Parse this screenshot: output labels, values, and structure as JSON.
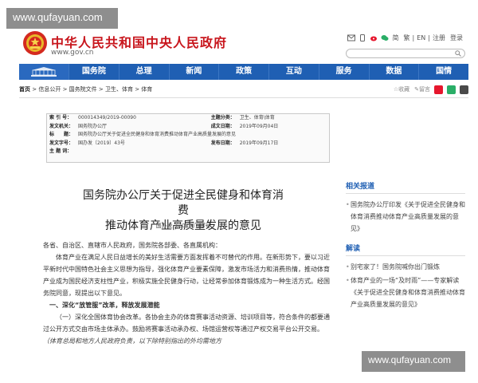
{
  "watermark": {
    "top": "www.qufayuan.com",
    "bottom": "www.qufayuan.com"
  },
  "header": {
    "title": "中华人民共和国中央人民政府",
    "url": "www.gov.cn",
    "links": [
      "简",
      "繁",
      "EN",
      "注册",
      "登录"
    ],
    "separators": [
      "|",
      "|"
    ]
  },
  "nav": {
    "items": [
      "国务院",
      "总理",
      "新闻",
      "政策",
      "互动",
      "服务",
      "数据",
      "国情"
    ]
  },
  "breadcrumb": {
    "items": [
      "首页",
      "信息公开",
      "国务院文件",
      "卫生、体育",
      "体育"
    ],
    "separator": " > ",
    "tools": {
      "favorite": "收藏",
      "print": "留言"
    }
  },
  "meta": {
    "rows": [
      {
        "k1": "索 引 号：",
        "v1": "000014349/2019-00090",
        "k2": "主题分类：",
        "v2": "卫生、体育\\体育"
      },
      {
        "k1": "发文机关：",
        "v1": "国务院办公厅",
        "k2": "成文日期：",
        "v2": "2019年09月04日"
      },
      {
        "k1": "标　　题：",
        "v1": "国务院办公厅关于促进全民健身和体育消费推动体育产业高质量发展的意见",
        "k2": "",
        "v2": ""
      },
      {
        "k1": "发文字号：",
        "v1": "国办发〔2019〕43号",
        "k2": "发布日期：",
        "v2": "2019年09月17日"
      },
      {
        "k1": "主 题 词：",
        "v1": "",
        "k2": "",
        "v2": ""
      }
    ]
  },
  "doc": {
    "title_line1": "国务院办公厅关于促进全民健身和体育消费",
    "title_line2": "推动体育产业高质量发展的意见",
    "number": "国办发〔2019〕43号",
    "salutation": "各省、自治区、直辖市人民政府，国务院各部委、各直属机构：",
    "p1": "体育产业在满足人民日益增长的美好生活需要方面发挥着不可替代的作用。在新形势下，要以习近平新时代中国特色社会主义思想为指导，强化体育产业要素保障，激发市场活力和消费热情，推动体育产业成为国民经济支柱性产业，积极实施全民健身行动，让经常参加体育锻炼成为一种生活方式。经国务院同意，现提出以下意见。",
    "h1": "一、深化“放管服”改革，释放发展潜能",
    "p2a": "（一）深化全国体育协会改革。各协会主办的体育赛事活动资源、培训项目等，符合条件的都要通过公开方式交由市场主体承办。鼓励将赛事活动承办权、场馆运营权等通过产权交易平台公开交易。",
    "p2b": "（体育总局和地方人民政府负责，以下除特别指出的外均需地方"
  },
  "sidebar": {
    "related_title": "相关报道",
    "related": [
      "国务院办公厅印发《关于促进全民健身和体育消费推动体育产业高质量发展的意见》"
    ],
    "interp_title": "解读",
    "interp": [
      "别宅家了！国务院喊你出门锻炼",
      "体育产业的一场“及时雨”——专家解读《关于促进全民健身和体育消费推动体育产业高质量发展的意见》"
    ]
  },
  "colors": {
    "brand_red": "#c8161d",
    "nav_blue": "#1f5fb3",
    "link_blue": "#1f5fb3"
  }
}
